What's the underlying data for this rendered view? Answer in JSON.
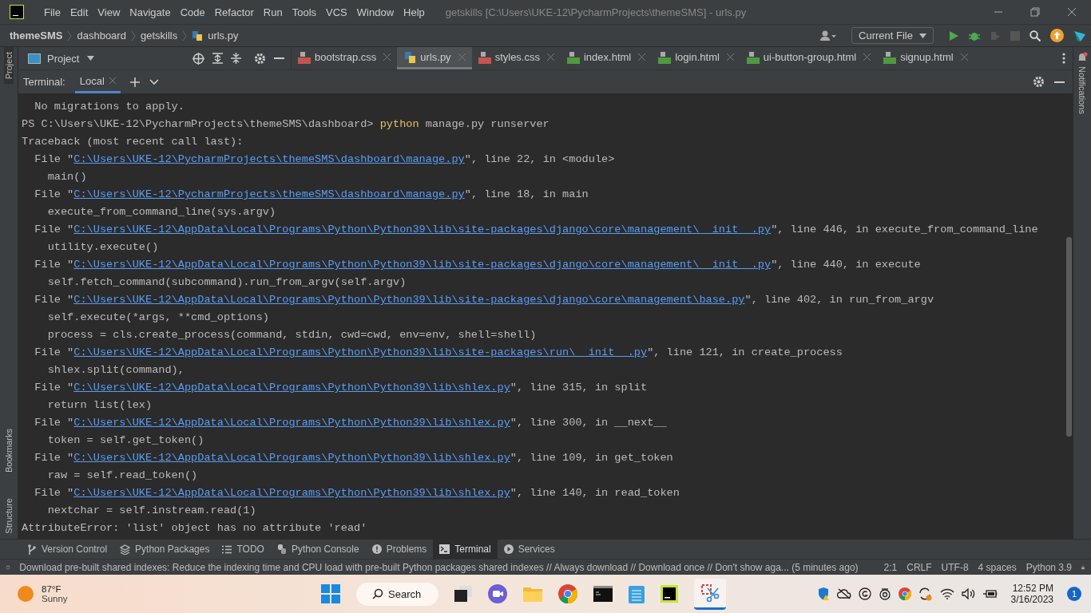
{
  "window": {
    "menu": [
      "File",
      "Edit",
      "View",
      "Navigate",
      "Code",
      "Refactor",
      "Run",
      "Tools",
      "VCS",
      "Window",
      "Help"
    ],
    "title": "getskills [C:\\Users\\UKE-12\\PycharmProjects\\themeSMS] - urls.py"
  },
  "breadcrumbs": [
    {
      "label": "themeSMS",
      "kind": "project"
    },
    {
      "label": "dashboard",
      "kind": "folder"
    },
    {
      "label": "getskills",
      "kind": "folder"
    },
    {
      "label": "urls.py",
      "kind": "file"
    }
  ],
  "run_config": "Current File",
  "left_strip": [
    "Project",
    "Bookmarks",
    "Structure"
  ],
  "right_strip": [
    "Notifications"
  ],
  "project_panel": {
    "label": "Project"
  },
  "tabs": [
    {
      "label": "bootstrap.css",
      "kind": "css",
      "selected": false
    },
    {
      "label": "urls.py",
      "kind": "py",
      "selected": true
    },
    {
      "label": "styles.css",
      "kind": "css",
      "selected": false
    },
    {
      "label": "index.html",
      "kind": "html",
      "selected": false
    },
    {
      "label": "login.html",
      "kind": "html",
      "selected": false
    },
    {
      "label": "ui-button-group.html",
      "kind": "html",
      "selected": false
    },
    {
      "label": "signup.html",
      "kind": "html",
      "selected": false
    }
  ],
  "terminal": {
    "label": "Terminal:",
    "tabs": [
      {
        "label": "Local",
        "selected": true
      }
    ],
    "lines": [
      [
        {
          "kind": "text",
          "text": "  No migrations to apply."
        }
      ],
      [
        {
          "kind": "text",
          "text": "PS C:\\Users\\UKE-12\\PycharmProjects\\themeSMS\\dashboard> "
        },
        {
          "kind": "command",
          "text": "python"
        },
        {
          "kind": "text",
          "text": " manage.py runserver"
        }
      ],
      [
        {
          "kind": "text",
          "text": "Traceback (most recent call last):"
        }
      ],
      [
        {
          "kind": "text",
          "text": "  File \""
        },
        {
          "kind": "link",
          "text": "C:\\Users\\UKE-12\\PycharmProjects\\themeSMS\\dashboard\\manage.py"
        },
        {
          "kind": "text",
          "text": "\", line 22, in <module>"
        }
      ],
      [
        {
          "kind": "text",
          "text": "    main()"
        }
      ],
      [
        {
          "kind": "text",
          "text": "  File \""
        },
        {
          "kind": "link",
          "text": "C:\\Users\\UKE-12\\PycharmProjects\\themeSMS\\dashboard\\manage.py"
        },
        {
          "kind": "text",
          "text": "\", line 18, in main"
        }
      ],
      [
        {
          "kind": "text",
          "text": "    execute_from_command_line(sys.argv)"
        }
      ],
      [
        {
          "kind": "text",
          "text": "  File \""
        },
        {
          "kind": "link",
          "text": "C:\\Users\\UKE-12\\AppData\\Local\\Programs\\Python\\Python39\\lib\\site-packages\\django\\core\\management\\__init__.py"
        },
        {
          "kind": "text",
          "text": "\", line 446, in execute_from_command_line"
        }
      ],
      [
        {
          "kind": "text",
          "text": "    utility.execute()"
        }
      ],
      [
        {
          "kind": "text",
          "text": "  File \""
        },
        {
          "kind": "link",
          "text": "C:\\Users\\UKE-12\\AppData\\Local\\Programs\\Python\\Python39\\lib\\site-packages\\django\\core\\management\\__init__.py"
        },
        {
          "kind": "text",
          "text": "\", line 440, in execute"
        }
      ],
      [
        {
          "kind": "text",
          "text": "    self.fetch_command(subcommand).run_from_argv(self.argv)"
        }
      ],
      [
        {
          "kind": "text",
          "text": "  File \""
        },
        {
          "kind": "link",
          "text": "C:\\Users\\UKE-12\\AppData\\Local\\Programs\\Python\\Python39\\lib\\site-packages\\django\\core\\management\\base.py"
        },
        {
          "kind": "text",
          "text": "\", line 402, in run_from_argv"
        }
      ],
      [
        {
          "kind": "text",
          "text": "    self.execute(*args, **cmd_options)"
        }
      ],
      [
        {
          "kind": "text",
          "text": "    process = cls.create_process(command, stdin, cwd=cwd, env=env, shell=shell)"
        }
      ],
      [
        {
          "kind": "text",
          "text": "  File \""
        },
        {
          "kind": "link",
          "text": "C:\\Users\\UKE-12\\AppData\\Local\\Programs\\Python\\Python39\\lib\\site-packages\\run\\__init__.py"
        },
        {
          "kind": "text",
          "text": "\", line 121, in create_process"
        }
      ],
      [
        {
          "kind": "text",
          "text": "    shlex.split(command),"
        }
      ],
      [
        {
          "kind": "text",
          "text": "  File \""
        },
        {
          "kind": "link",
          "text": "C:\\Users\\UKE-12\\AppData\\Local\\Programs\\Python\\Python39\\lib\\shlex.py"
        },
        {
          "kind": "text",
          "text": "\", line 315, in split"
        }
      ],
      [
        {
          "kind": "text",
          "text": "    return list(lex)"
        }
      ],
      [
        {
          "kind": "text",
          "text": "  File \""
        },
        {
          "kind": "link",
          "text": "C:\\Users\\UKE-12\\AppData\\Local\\Programs\\Python\\Python39\\lib\\shlex.py"
        },
        {
          "kind": "text",
          "text": "\", line 300, in __next__"
        }
      ],
      [
        {
          "kind": "text",
          "text": "    token = self.get_token()"
        }
      ],
      [
        {
          "kind": "text",
          "text": "  File \""
        },
        {
          "kind": "link",
          "text": "C:\\Users\\UKE-12\\AppData\\Local\\Programs\\Python\\Python39\\lib\\shlex.py"
        },
        {
          "kind": "text",
          "text": "\", line 109, in get_token"
        }
      ],
      [
        {
          "kind": "text",
          "text": "    raw = self.read_token()"
        }
      ],
      [
        {
          "kind": "text",
          "text": "  File \""
        },
        {
          "kind": "link",
          "text": "C:\\Users\\UKE-12\\AppData\\Local\\Programs\\Python\\Python39\\lib\\shlex.py"
        },
        {
          "kind": "text",
          "text": "\", line 140, in read_token"
        }
      ],
      [
        {
          "kind": "text",
          "text": "    nextchar = self.instream.read(1)"
        }
      ],
      [
        {
          "kind": "text",
          "text": "AttributeError: 'list' object has no attribute 'read'"
        }
      ]
    ]
  },
  "tool_windows": [
    {
      "label": "Version Control",
      "kind": "vcs",
      "selected": false
    },
    {
      "label": "Python Packages",
      "kind": "packages",
      "selected": false
    },
    {
      "label": "TODO",
      "kind": "todo",
      "selected": false
    },
    {
      "label": "Python Console",
      "kind": "console",
      "selected": false
    },
    {
      "label": "Problems",
      "kind": "problems",
      "selected": false
    },
    {
      "label": "Terminal",
      "kind": "terminal",
      "selected": true
    },
    {
      "label": "Services",
      "kind": "services",
      "selected": false
    }
  ],
  "status_bar": {
    "message": "Download pre-built shared indexes: Reduce the indexing time and CPU load with pre-built Python packages shared indexes // Always download // Download once // Don't show aga... (5 minutes ago)",
    "items": [
      "2:1",
      "CRLF",
      "UTF-8",
      "4 spaces",
      "Python 3.9"
    ]
  },
  "taskbar": {
    "weather": {
      "temp": "87°F",
      "condition": "Sunny"
    },
    "search": "Search",
    "time": "12:52 PM",
    "date": "3/16/2023",
    "notifications": "1"
  }
}
